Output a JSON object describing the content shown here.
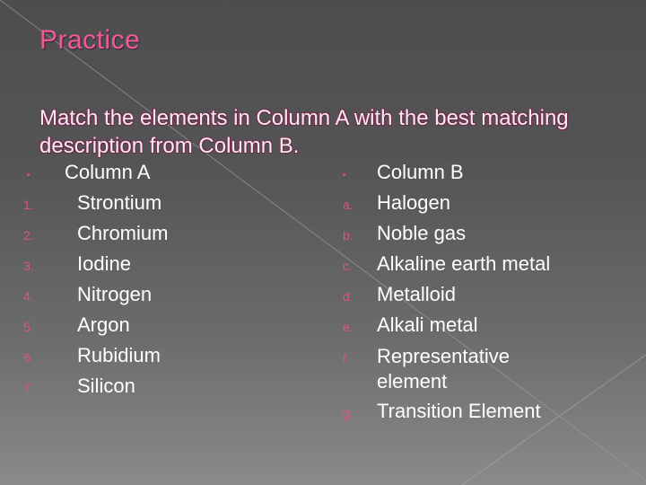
{
  "slide": {
    "title": "Practice",
    "instructions": "Match the elements in Column A with the best matching description from Column B.",
    "colors": {
      "title": "#f05a9a",
      "marker": "#e0508c",
      "body_text": "#ffffff"
    }
  },
  "column_a": {
    "heading": "Column A",
    "items": [
      {
        "marker": "1.",
        "text": "Strontium"
      },
      {
        "marker": "2.",
        "text": "Chromium"
      },
      {
        "marker": "3.",
        "text": "Iodine"
      },
      {
        "marker": "4.",
        "text": "Nitrogen"
      },
      {
        "marker": "5.",
        "text": "Argon"
      },
      {
        "marker": "6.",
        "text": "Rubidium"
      },
      {
        "marker": "7.",
        "text": "Silicon"
      }
    ]
  },
  "column_b": {
    "heading": "Column B",
    "items": [
      {
        "marker": "a.",
        "text": "Halogen"
      },
      {
        "marker": "b.",
        "text": "Noble gas"
      },
      {
        "marker": "c.",
        "text": "Alkaline earth metal"
      },
      {
        "marker": "d.",
        "text": "Metalloid"
      },
      {
        "marker": "e.",
        "text": "Alkali metal"
      },
      {
        "marker": "f.",
        "text": "Representative element"
      },
      {
        "marker": "g.",
        "text": "Transition Element"
      }
    ]
  }
}
